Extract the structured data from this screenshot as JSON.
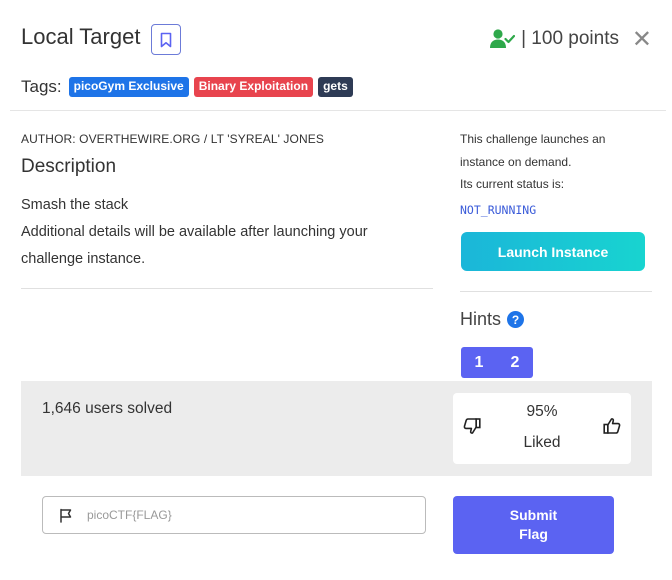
{
  "challenge": {
    "title": "Local Target",
    "points": "| 100 points"
  },
  "tags": {
    "label": "Tags:",
    "items": [
      "picoGym Exclusive",
      "Binary Exploitation",
      "gets"
    ]
  },
  "details": {
    "author": "AUTHOR: OVERTHEWIRE.ORG / LT 'SYREAL' JONES",
    "description_title": "Description",
    "description_line1": "Smash the stack",
    "description_line2": "Additional details will be available after launching your challenge instance."
  },
  "instance": {
    "line1": "This challenge launches an instance on demand.",
    "line2": "Its current status is:",
    "status": "NOT_RUNNING",
    "launch_label": "Launch Instance"
  },
  "hints": {
    "title": "Hints",
    "buttons": [
      "1",
      "2"
    ]
  },
  "stats": {
    "solved": "1,646 users solved",
    "liked_percent": "95%",
    "liked_label": "Liked"
  },
  "flag": {
    "placeholder": "picoCTF{FLAG}",
    "value": "",
    "submit_label": "Submit Flag"
  },
  "colors": {
    "accent": "#5b63f2",
    "tag_blue": "#1e74e8",
    "tag_red": "#e8444e",
    "tag_dark": "#2e3b55",
    "launch_start": "#1bb6d9",
    "launch_end": "#18d4d0",
    "status_text": "#3a5bd9",
    "user_icon": "#2ea84a"
  },
  "icons": [
    "bookmark-icon",
    "user-check-icon",
    "close-icon",
    "help-icon",
    "thumbs-down-icon",
    "thumbs-up-icon",
    "flag-icon"
  ]
}
